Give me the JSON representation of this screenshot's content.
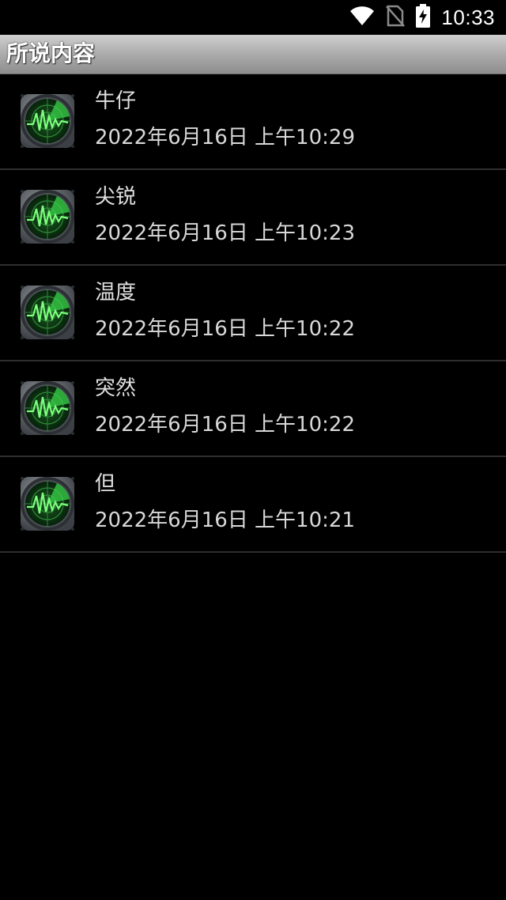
{
  "status_bar": {
    "time": "10:33",
    "icons": [
      "wifi-icon",
      "no-sim-icon",
      "battery-charging-icon"
    ]
  },
  "header": {
    "title": "所说内容"
  },
  "list": {
    "item_icon": "radar-icon",
    "items": [
      {
        "title": "牛仔",
        "date": "2022年6月16日 上午10:29"
      },
      {
        "title": "尖锐",
        "date": "2022年6月16日 上午10:23"
      },
      {
        "title": "温度",
        "date": "2022年6月16日 上午10:22"
      },
      {
        "title": "突然",
        "date": "2022年6月16日 上午10:22"
      },
      {
        "title": "但",
        "date": "2022年6月16日 上午10:21"
      }
    ]
  },
  "colors": {
    "background": "#000000",
    "radar_green": "#39d34a",
    "bezel_gray": "#6b6f73"
  }
}
